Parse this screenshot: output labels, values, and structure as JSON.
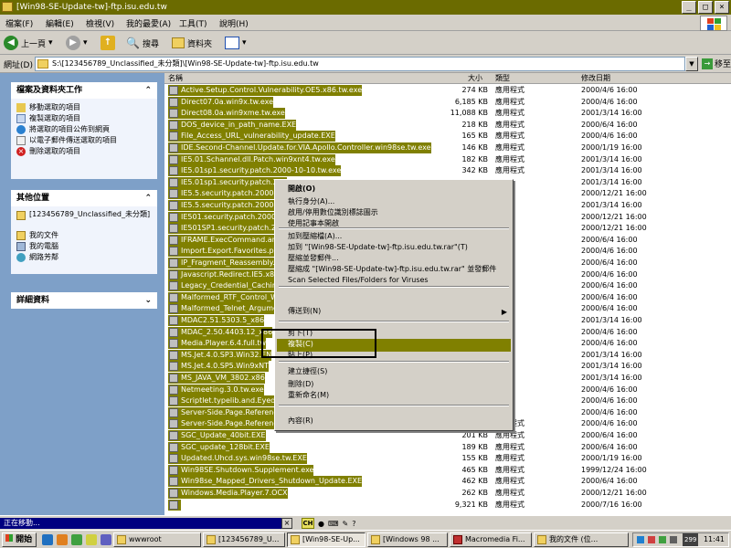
{
  "window": {
    "title": "[Win98-SE-Update-tw]-ftp.isu.edu.tw",
    "buttons": [
      "_",
      "□",
      "×"
    ]
  },
  "menu": [
    "檔案(F)",
    "編輯(E)",
    "檢視(V)",
    "我的最愛(A)",
    "工具(T)",
    "說明(H)"
  ],
  "toolbar": {
    "back": "上一頁",
    "search": "搜尋",
    "folders": "資料夾"
  },
  "address": {
    "label": "網址(D)",
    "value": "S:\\[123456789_Unclassified_未分類]\\[Win98-SE-Update-tw]-ftp.isu.edu.tw",
    "go": "移至"
  },
  "left": {
    "file_tasks": {
      "title": "檔案及資料夾工作",
      "items": [
        "移動選取的項目",
        "複製選取的項目",
        "將選取的項目公佈到網頁",
        "以電子郵件傳送選取的項目",
        "刪除選取的項目"
      ]
    },
    "other_places": {
      "title": "其他位置",
      "items": [
        "[123456789_Unclassified_未分類]",
        "我的文件",
        "我的電腦",
        "網路芳鄰"
      ]
    },
    "details": {
      "title": "詳細資料"
    }
  },
  "columns": {
    "name": "名稱",
    "size": "大小",
    "type": "類型",
    "modified": "修改日期"
  },
  "files": [
    {
      "name": "Active.Setup.Control.Vulnerability.OE5.x86.tw.exe",
      "size": "274 KB",
      "type": "應用程式",
      "date": "2000/4/6 16:00"
    },
    {
      "name": "Direct07.0a.win9x.tw.exe",
      "size": "6,185 KB",
      "type": "應用程式",
      "date": "2000/4/6 16:00"
    },
    {
      "name": "Direct08.0a.win9xme.tw.exe",
      "size": "11,088 KB",
      "type": "應用程式",
      "date": "2001/3/14 16:00"
    },
    {
      "name": "DOS_device_in_path_name.EXE",
      "size": "218 KB",
      "type": "應用程式",
      "date": "2000/6/4 16:00"
    },
    {
      "name": "File_Access_URL_vulnerability_update.EXE",
      "size": "165 KB",
      "type": "應用程式",
      "date": "2000/4/6 16:00"
    },
    {
      "name": "IDE.Second-Channel.Update.for.VIA.Apollo.Controller.win98se.tw.exe",
      "size": "146 KB",
      "type": "應用程式",
      "date": "2000/1/19 16:00"
    },
    {
      "name": "IE5.01.Schannel.dll.Patch.win9xnt4.tw.exe",
      "size": "182 KB",
      "type": "應用程式",
      "date": "2001/3/14 16:00"
    },
    {
      "name": "IE5.01sp1.security.patch.2000-10-10.tw.exe",
      "size": "342 KB",
      "type": "應用程式",
      "date": "2001/3/14 16:00"
    },
    {
      "name": "IE5.01sp1.security.patch.200",
      "size": "",
      "type": "",
      "date": "2001/3/14 16:00"
    },
    {
      "name": "IE5.5.security.patch.2000-8-",
      "size": "",
      "type": "",
      "date": "2000/12/21 16:00"
    },
    {
      "name": "IE5.5.security.patch.2000-11-",
      "size": "",
      "type": "",
      "date": "2001/3/14 16:00"
    },
    {
      "name": "IE501.security.patch.2000-8-",
      "size": "",
      "type": "",
      "date": "2000/12/21 16:00"
    },
    {
      "name": "IE501SP1.security.patch.200",
      "size": "",
      "type": "",
      "date": "2000/12/21 16:00"
    },
    {
      "name": "IFRAME.ExecCommand.an",
      "size": "",
      "type": "",
      "date": "2000/6/4 16:00"
    },
    {
      "name": "Import.Export.Favorites.patc",
      "size": "",
      "type": "",
      "date": "2000/4/6 16:00"
    },
    {
      "name": "IP_Fragment_Reassembly.E",
      "size": "",
      "type": "",
      "date": "2000/6/4 16:00"
    },
    {
      "name": "Javascript.Redirect.IE5.x86",
      "size": "",
      "type": "",
      "date": "2000/4/6 16:00"
    },
    {
      "name": "Legacy_Credential_Caching",
      "size": "",
      "type": "",
      "date": "2000/6/4 16:00"
    },
    {
      "name": "Malformed_RTF_Control_W",
      "size": "",
      "type": "",
      "date": "2000/6/4 16:00"
    },
    {
      "name": "Malformed_Telnet_Argume",
      "size": "",
      "type": "",
      "date": "2000/6/4 16:00"
    },
    {
      "name": "MDAC2.51.5303.5_x86",
      "size": "",
      "type": "",
      "date": "2001/3/14 16:00"
    },
    {
      "name": "MDAC_2.50.4403.12_x86",
      "size": "",
      "type": "",
      "date": "2000/4/6 16:00"
    },
    {
      "name": "Media.Player.6.4.full.tw",
      "size": "",
      "type": "",
      "date": "2000/4/6 16:00"
    },
    {
      "name": "MS.Jet.4.0.SP3.Win32.EN",
      "size": "",
      "type": "",
      "date": "2001/3/14 16:00"
    },
    {
      "name": "MS.Jet.4.0.SP5.Win9xNT",
      "size": "",
      "type": "",
      "date": "2001/3/14 16:00"
    },
    {
      "name": "MS_JAVA_VM_3802.x86",
      "size": "",
      "type": "",
      "date": "2001/3/14 16:00"
    },
    {
      "name": "Netmeeting.3.0.tw.exe",
      "size": "",
      "type": "",
      "date": "2000/4/6 16:00"
    },
    {
      "name": "Scriptlet.typelib.and.Eyedog",
      "size": "",
      "type": "",
      "date": "2000/4/6 16:00"
    },
    {
      "name": "Server-Side.Page.Reference",
      "size": "",
      "type": "",
      "date": "2000/4/6 16:00"
    },
    {
      "name": "Server-Side.Page.Reference.Redirect.IE501.x86.tw.exe",
      "size": "484 KB",
      "type": "應用程式",
      "date": "2000/4/6 16:00"
    },
    {
      "name": "SGC_Update_40bit.EXE",
      "size": "201 KB",
      "type": "應用程式",
      "date": "2000/6/4 16:00"
    },
    {
      "name": "SGC_update_128bit.EXE",
      "size": "189 KB",
      "type": "應用程式",
      "date": "2000/6/4 16:00"
    },
    {
      "name": "Updated.Uhcd.sys.win98se.tw.EXE",
      "size": "155 KB",
      "type": "應用程式",
      "date": "2000/1/19 16:00"
    },
    {
      "name": "Win98SE.Shutdown.Supplement.exe",
      "size": "465 KB",
      "type": "應用程式",
      "date": "1999/12/24 16:00"
    },
    {
      "name": "Win98se_Mapped_Drivers_Shutdown_Update.EXE",
      "size": "462 KB",
      "type": "應用程式",
      "date": "2000/6/4 16:00"
    },
    {
      "name": "Windows.Media.Player.7.OCX",
      "size": "262 KB",
      "type": "應用程式",
      "date": "2000/12/21 16:00"
    },
    {
      "name": "",
      "size": "9,321 KB",
      "type": "應用程式",
      "date": "2000/7/16 16:00"
    }
  ],
  "context_menu": [
    {
      "label": "開啟(O)",
      "bold": true
    },
    {
      "label": "執行身分(A)..."
    },
    {
      "label": "啟用/停用數位識別標誌圖示"
    },
    {
      "label": "使用記事本開啟"
    },
    {
      "label": "加到壓縮檔(A)..."
    },
    {
      "label": "加到 \"[Win98-SE-Update-tw]-ftp.isu.edu.tw.rar\"(T)"
    },
    {
      "label": "壓縮並發郵件..."
    },
    {
      "label": "壓縮成 \"[Win98-SE-Update-tw]-ftp.isu.edu.tw.rar\" 並發郵件"
    },
    {
      "label": "Scan Selected Files/Folders for Viruses"
    },
    {
      "label": "傳送到(N)"
    },
    {
      "label": "剪下(T)"
    },
    {
      "label": "複製(C)"
    },
    {
      "label": "貼上(P)"
    },
    {
      "label": "建立捷徑(S)"
    },
    {
      "label": "刪除(D)"
    },
    {
      "label": "重新命名(M)"
    },
    {
      "label": "內容(R)"
    }
  ],
  "status": {
    "moving": "正在移動...",
    "lang": "CH"
  },
  "taskbar": {
    "start": "開始",
    "buttons": [
      "wwwroot",
      "[123456789_U...",
      "[Win98-SE-Up...",
      "[Windows 98 ...",
      "Macromedia Fi...",
      "我的文件 (位..."
    ],
    "clock": "11:41",
    "tray_num": "299"
  },
  "colors": {
    "selection": "#808000",
    "title": "#6b6b00",
    "leftpane": "#7ea0c8"
  }
}
